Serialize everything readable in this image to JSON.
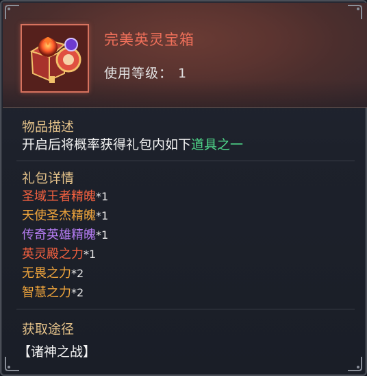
{
  "item": {
    "name": "完美英灵宝箱",
    "level_label": "使用等级：",
    "level_value": "1",
    "icon": "treasure-chest-icon"
  },
  "description": {
    "title": "物品描述",
    "text_prefix": "开启后将概率获得礼包内如下",
    "text_highlight": "道具之一"
  },
  "gift_details": {
    "title": "礼包详情",
    "items": [
      {
        "name": "圣域王者精魄",
        "qty": "*1",
        "color": "#f2603f"
      },
      {
        "name": "天使圣杰精魄",
        "qty": "*1",
        "color": "#f0a53c"
      },
      {
        "name": "传奇英雄精魄",
        "qty": "*1",
        "color": "#b57cf2"
      },
      {
        "name": "英灵殿之力",
        "qty": "*1",
        "color": "#f2603f"
      },
      {
        "name": "无畏之力",
        "qty": "*2",
        "color": "#f0a53c"
      },
      {
        "name": "智慧之力",
        "qty": "*2",
        "color": "#f0a53c"
      }
    ]
  },
  "source": {
    "title": "获取途径",
    "value": "【诸神之战】"
  },
  "colors": {
    "name": "#f0705a",
    "section_title": "#e4c28a",
    "highlight": "#4fd88a"
  }
}
